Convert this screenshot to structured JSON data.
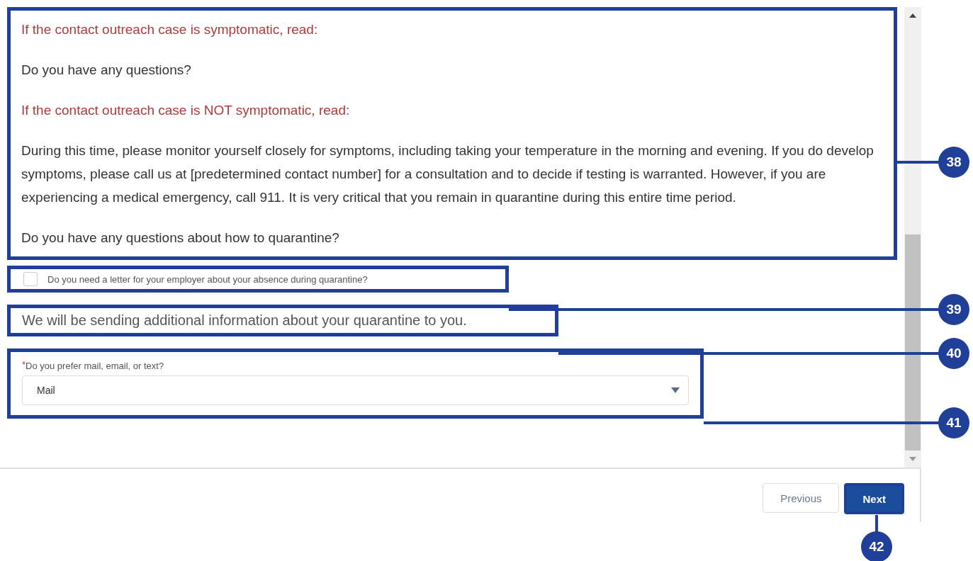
{
  "script": [
    {
      "kind": "instruction",
      "text": "If the contact outreach case is symptomatic, read:"
    },
    {
      "kind": "speech",
      "text": "Do you have any questions?"
    },
    {
      "kind": "instruction",
      "text": "If the contact outreach case is NOT symptomatic, read:"
    },
    {
      "kind": "speech",
      "text": "During this time, please monitor yourself closely for symptoms, including taking your temperature in the morning and evening. If you do develop symptoms, please call us at [predetermined contact number] for a consultation and to decide if testing is warranted. However, if you are experiencing a medical emergency, call 911. It is very critical that you remain in quarantine during this entire time period."
    },
    {
      "kind": "speech",
      "text": "Do you have any questions about how to quarantine?"
    }
  ],
  "letter_checkbox": {
    "label": "Do you need a letter for your employer about your absence during quarantine?",
    "checked": false
  },
  "info_text": "We will be sending additional information about your quarantine to you.",
  "delivery_select": {
    "required_mark": "*",
    "label": "Do you prefer mail, email, or text?",
    "value": "Mail"
  },
  "buttons": [
    {
      "label": "Previous",
      "kind": "secondary"
    },
    {
      "label": "Next",
      "kind": "primary"
    }
  ],
  "callouts": [
    {
      "number": "38"
    },
    {
      "number": "39"
    },
    {
      "number": "40"
    },
    {
      "number": "41"
    },
    {
      "number": "42"
    }
  ]
}
